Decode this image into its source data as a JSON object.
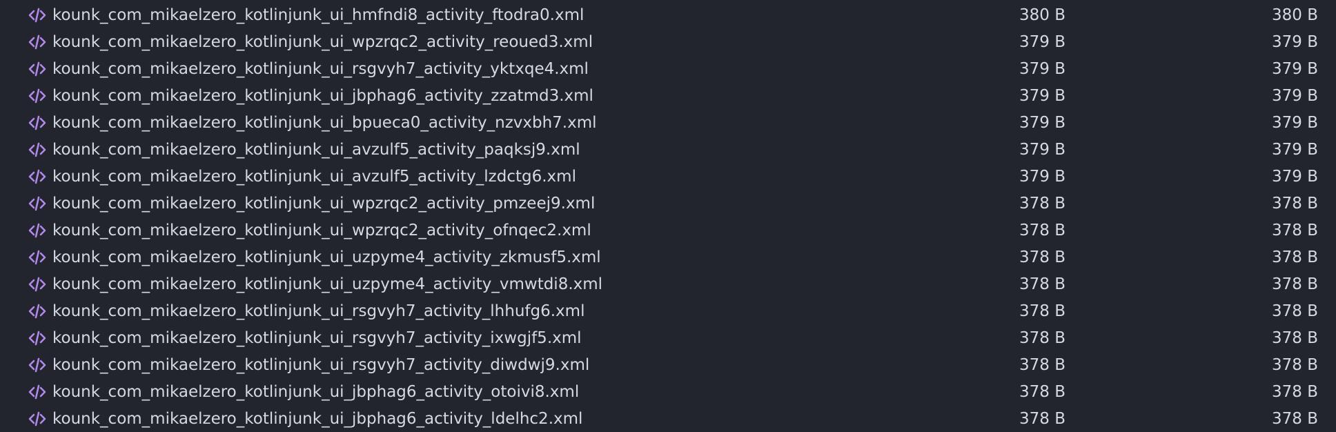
{
  "icon_color": "#b388eb",
  "files": [
    {
      "name": "kounk_com_mikaelzero_kotlinjunk_ui_hmfndi8_activity_ftodra0.xml",
      "size": "380 B",
      "size_alt": "380 B"
    },
    {
      "name": "kounk_com_mikaelzero_kotlinjunk_ui_wpzrqc2_activity_reoued3.xml",
      "size": "379 B",
      "size_alt": "379 B"
    },
    {
      "name": "kounk_com_mikaelzero_kotlinjunk_ui_rsgvyh7_activity_yktxqe4.xml",
      "size": "379 B",
      "size_alt": "379 B"
    },
    {
      "name": "kounk_com_mikaelzero_kotlinjunk_ui_jbphag6_activity_zzatmd3.xml",
      "size": "379 B",
      "size_alt": "379 B"
    },
    {
      "name": "kounk_com_mikaelzero_kotlinjunk_ui_bpueca0_activity_nzvxbh7.xml",
      "size": "379 B",
      "size_alt": "379 B"
    },
    {
      "name": "kounk_com_mikaelzero_kotlinjunk_ui_avzulf5_activity_paqksj9.xml",
      "size": "379 B",
      "size_alt": "379 B"
    },
    {
      "name": "kounk_com_mikaelzero_kotlinjunk_ui_avzulf5_activity_lzdctg6.xml",
      "size": "379 B",
      "size_alt": "379 B"
    },
    {
      "name": "kounk_com_mikaelzero_kotlinjunk_ui_wpzrqc2_activity_pmzeej9.xml",
      "size": "378 B",
      "size_alt": "378 B"
    },
    {
      "name": "kounk_com_mikaelzero_kotlinjunk_ui_wpzrqc2_activity_ofnqec2.xml",
      "size": "378 B",
      "size_alt": "378 B"
    },
    {
      "name": "kounk_com_mikaelzero_kotlinjunk_ui_uzpyme4_activity_zkmusf5.xml",
      "size": "378 B",
      "size_alt": "378 B"
    },
    {
      "name": "kounk_com_mikaelzero_kotlinjunk_ui_uzpyme4_activity_vmwtdi8.xml",
      "size": "378 B",
      "size_alt": "378 B"
    },
    {
      "name": "kounk_com_mikaelzero_kotlinjunk_ui_rsgvyh7_activity_lhhufg6.xml",
      "size": "378 B",
      "size_alt": "378 B"
    },
    {
      "name": "kounk_com_mikaelzero_kotlinjunk_ui_rsgvyh7_activity_ixwgjf5.xml",
      "size": "378 B",
      "size_alt": "378 B"
    },
    {
      "name": "kounk_com_mikaelzero_kotlinjunk_ui_rsgvyh7_activity_diwdwj9.xml",
      "size": "378 B",
      "size_alt": "378 B"
    },
    {
      "name": "kounk_com_mikaelzero_kotlinjunk_ui_jbphag6_activity_otoivi8.xml",
      "size": "378 B",
      "size_alt": "378 B"
    },
    {
      "name": "kounk_com_mikaelzero_kotlinjunk_ui_jbphag6_activity_ldelhc2.xml",
      "size": "378 B",
      "size_alt": "378 B"
    }
  ]
}
